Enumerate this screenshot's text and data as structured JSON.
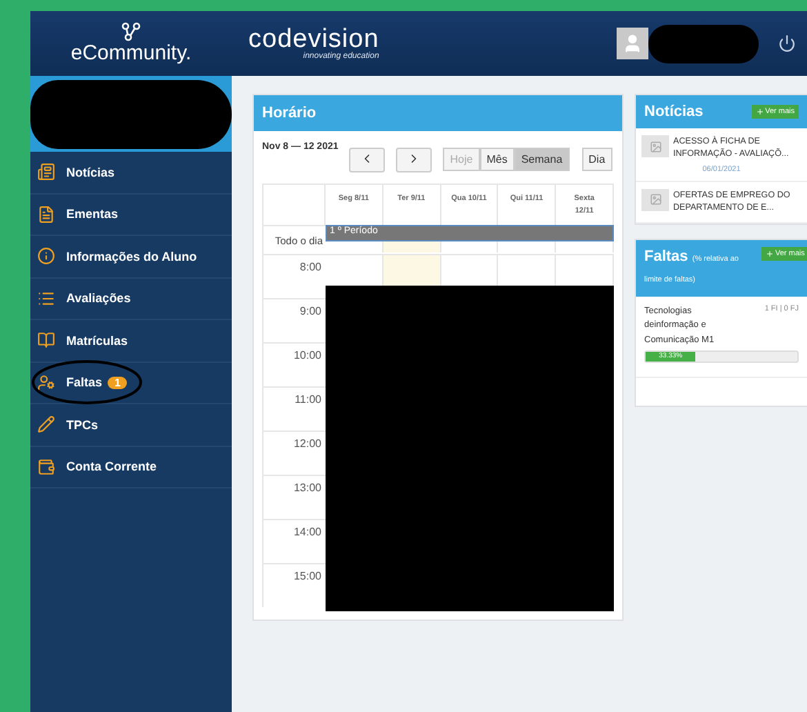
{
  "header": {
    "app_name": "eCommunity.",
    "brand": "codevision",
    "tagline": "innovating education"
  },
  "sidebar": {
    "items": [
      {
        "label": "Notícias",
        "circled": false
      },
      {
        "label": "Ementas",
        "circled": false
      },
      {
        "label": "Informações do Aluno",
        "circled": false
      },
      {
        "label": "Avaliações",
        "circled": false
      },
      {
        "label": "Matrículas",
        "circled": false
      },
      {
        "label": "Faltas",
        "badge": "1",
        "circled": true
      },
      {
        "label": "TPCs",
        "circled": false
      },
      {
        "label": "Conta Corrente",
        "circled": false
      }
    ]
  },
  "schedule": {
    "title": "Horário",
    "range": "Nov 8 — 12 2021",
    "views": [
      {
        "label": "Hoje",
        "selected": false,
        "disabled": true
      },
      {
        "label": "Mês",
        "selected": false,
        "disabled": false
      },
      {
        "label": "Semana",
        "selected": true,
        "disabled": false
      },
      {
        "label": "Dia",
        "selected": false,
        "disabled": false
      }
    ],
    "columns": [
      {
        "label": "Seg 8/11",
        "today": false
      },
      {
        "label": "Ter 9/11",
        "today": true
      },
      {
        "label": "Qua 10/11",
        "today": false
      },
      {
        "label": "Qui 11/11",
        "today": false
      },
      {
        "label": "Sexta 12/11",
        "today": false
      }
    ],
    "all_day_label": "Todo o dia",
    "all_day_event": "1 º Período",
    "times": [
      "8:00",
      "9:00",
      "10:00",
      "11:00",
      "12:00",
      "13:00",
      "14:00",
      "15:00"
    ]
  },
  "news": {
    "title": "Notícias",
    "more": "Ver mais",
    "items": [
      {
        "title": "ACESSO À FICHA DE INFORMAÇÃO - AVALIAÇÕ...",
        "date": "06/01/2021"
      },
      {
        "title": "OFERTAS DE EMPREGO DO DEPARTAMENTO DE E..."
      }
    ]
  },
  "absences": {
    "title": "Faltas",
    "subtitle": "(% relativa ao limite de faltas)",
    "more": "Ver mais",
    "items": [
      {
        "subject": "Tecnologias deinformação e Comunicação M1",
        "counts": "1 FI | 0 FJ",
        "level": 0.33,
        "percent": "33.33%"
      }
    ]
  }
}
